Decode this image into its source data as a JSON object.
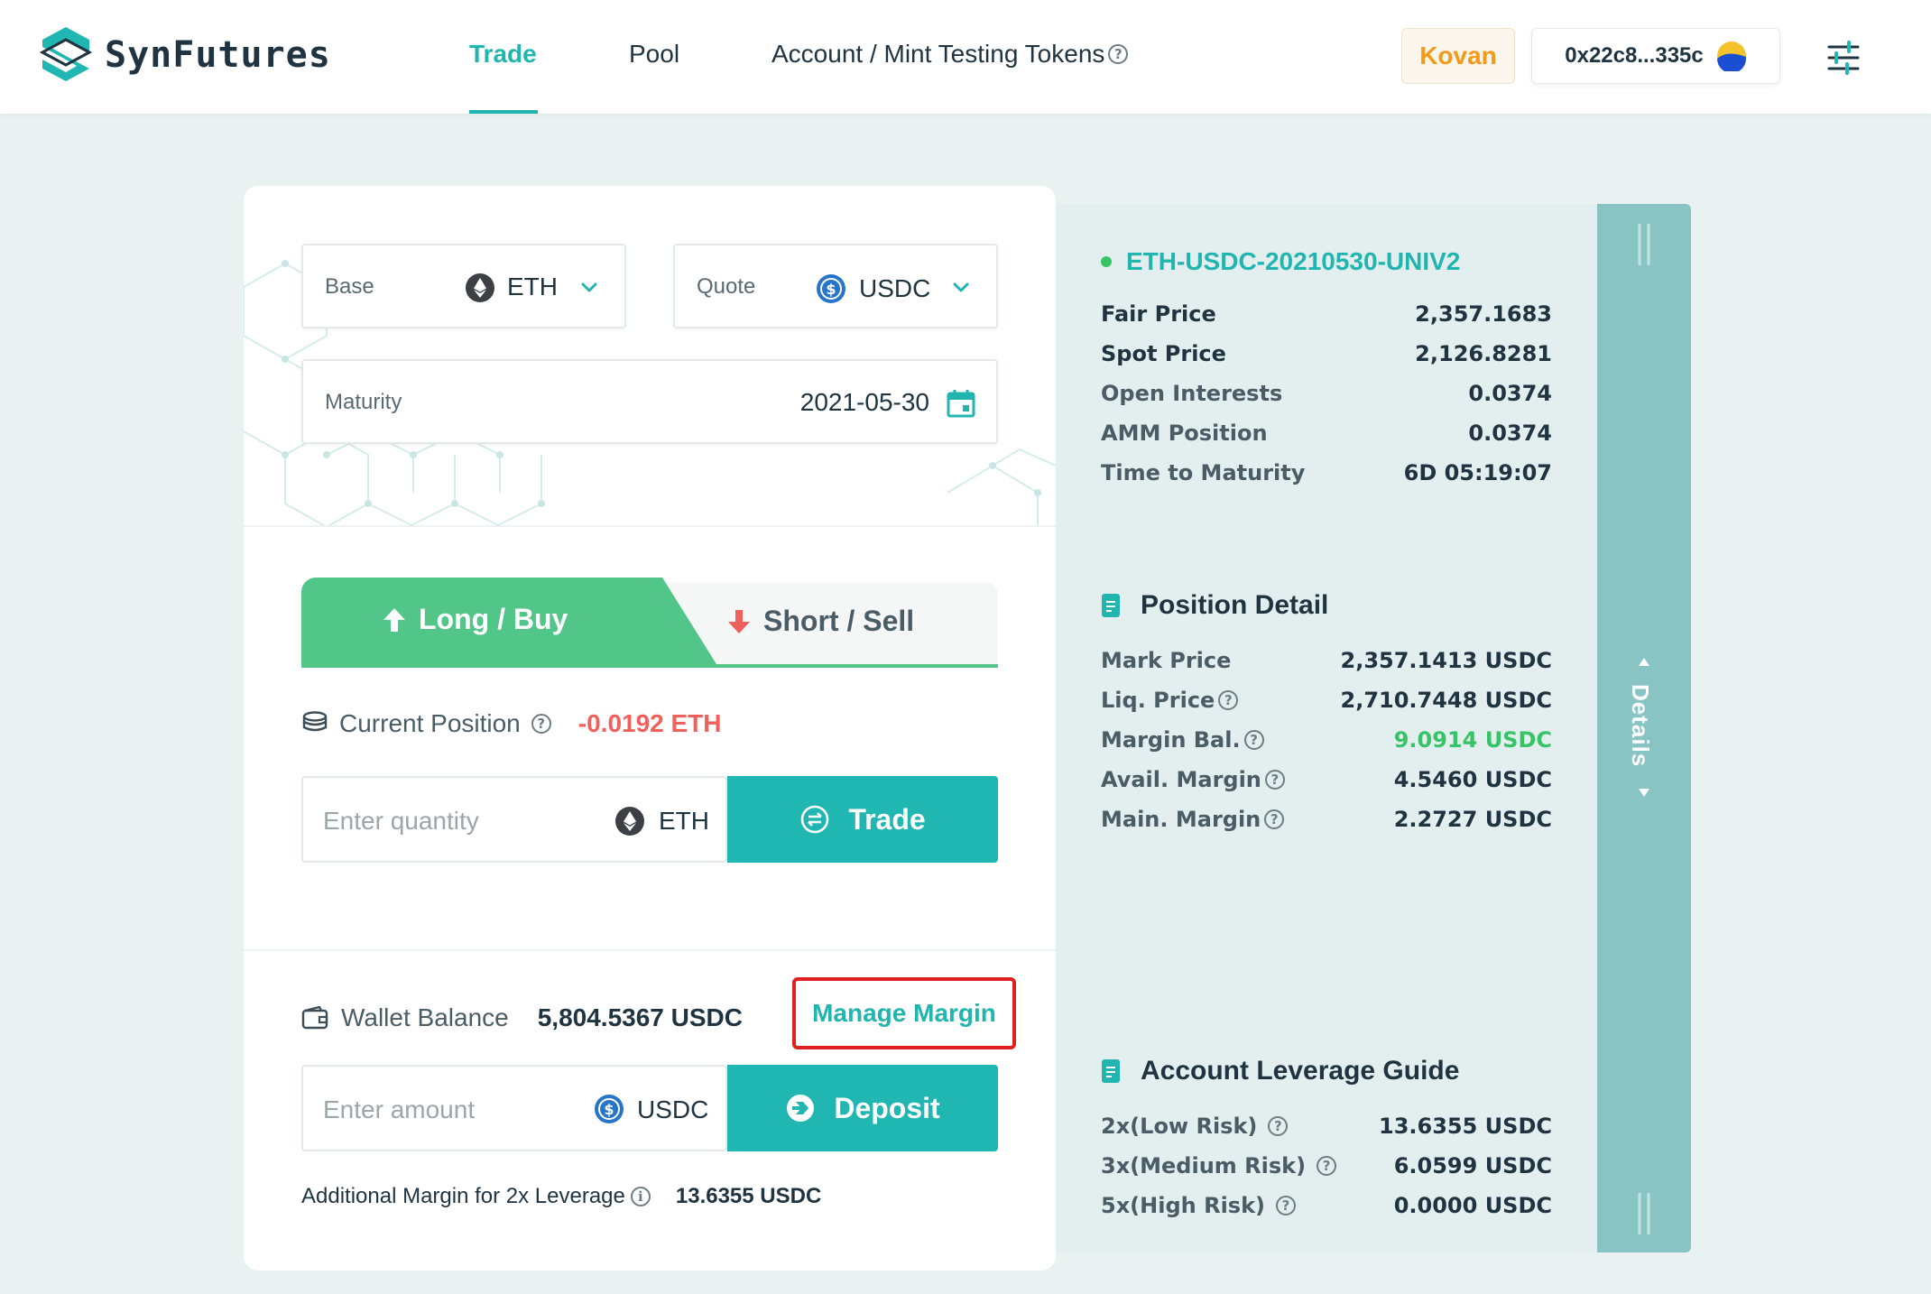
{
  "header": {
    "logo_text": "SynFutures",
    "nav": {
      "trade": "Trade",
      "pool": "Pool",
      "account": "Account / Mint Testing Tokens"
    },
    "network": "Kovan",
    "wallet_address": "0x22c8...335c"
  },
  "selectors": {
    "base_label": "Base",
    "base_value": "ETH",
    "quote_label": "Quote",
    "quote_value": "USDC",
    "maturity_label": "Maturity",
    "maturity_value": "2021-05-30"
  },
  "trade_tabs": {
    "long": "Long / Buy",
    "short": "Short / Sell",
    "active": "long"
  },
  "position": {
    "label": "Current Position",
    "value": "-0.0192 ETH"
  },
  "trade_form": {
    "placeholder": "Enter quantity",
    "unit": "ETH",
    "button": "Trade"
  },
  "wallet": {
    "label": "Wallet Balance",
    "value": "5,804.5367 USDC",
    "manage_margin": "Manage Margin"
  },
  "deposit_form": {
    "placeholder": "Enter amount",
    "unit": "USDC",
    "button": "Deposit"
  },
  "additional_margin": {
    "label": "Additional Margin for 2x Leverage",
    "value": "13.6355 USDC"
  },
  "market": {
    "pair": "ETH-USDC-20210530-UNIV2",
    "rows": [
      {
        "label": "Fair Price",
        "value": "2,357.1683"
      },
      {
        "label": "Spot Price",
        "value": "2,126.8281"
      },
      {
        "label": "Open Interests",
        "value": "0.0374"
      },
      {
        "label": "AMM Position",
        "value": "0.0374"
      },
      {
        "label": "Time to Maturity",
        "value": "6D 05:19:07"
      }
    ]
  },
  "position_detail": {
    "title": "Position Detail",
    "rows": [
      {
        "label": "Mark Price",
        "value": "2,357.1413 USDC"
      },
      {
        "label": "Liq. Price",
        "value": "2,710.7448 USDC"
      },
      {
        "label": "Margin Bal.",
        "value": "9.0914 USDC"
      },
      {
        "label": "Avail. Margin",
        "value": "4.5460 USDC"
      },
      {
        "label": "Main. Margin",
        "value": "2.2727 USDC"
      }
    ]
  },
  "leverage_guide": {
    "title": "Account Leverage Guide",
    "rows": [
      {
        "label": "2x(Low Risk)",
        "value": "13.6355 USDC"
      },
      {
        "label": "3x(Medium Risk)",
        "value": "6.0599 USDC"
      },
      {
        "label": "5x(High Risk)",
        "value": "0.0000 USDC"
      }
    ]
  },
  "details_tab": "Details",
  "colors": {
    "accent": "#22b5b0",
    "long": "#52c688",
    "short_arrow": "#f0605d",
    "negative": "#f0605d",
    "positive": "#36c466",
    "network": "#f39a1b",
    "highlight_box": "#e02020"
  }
}
